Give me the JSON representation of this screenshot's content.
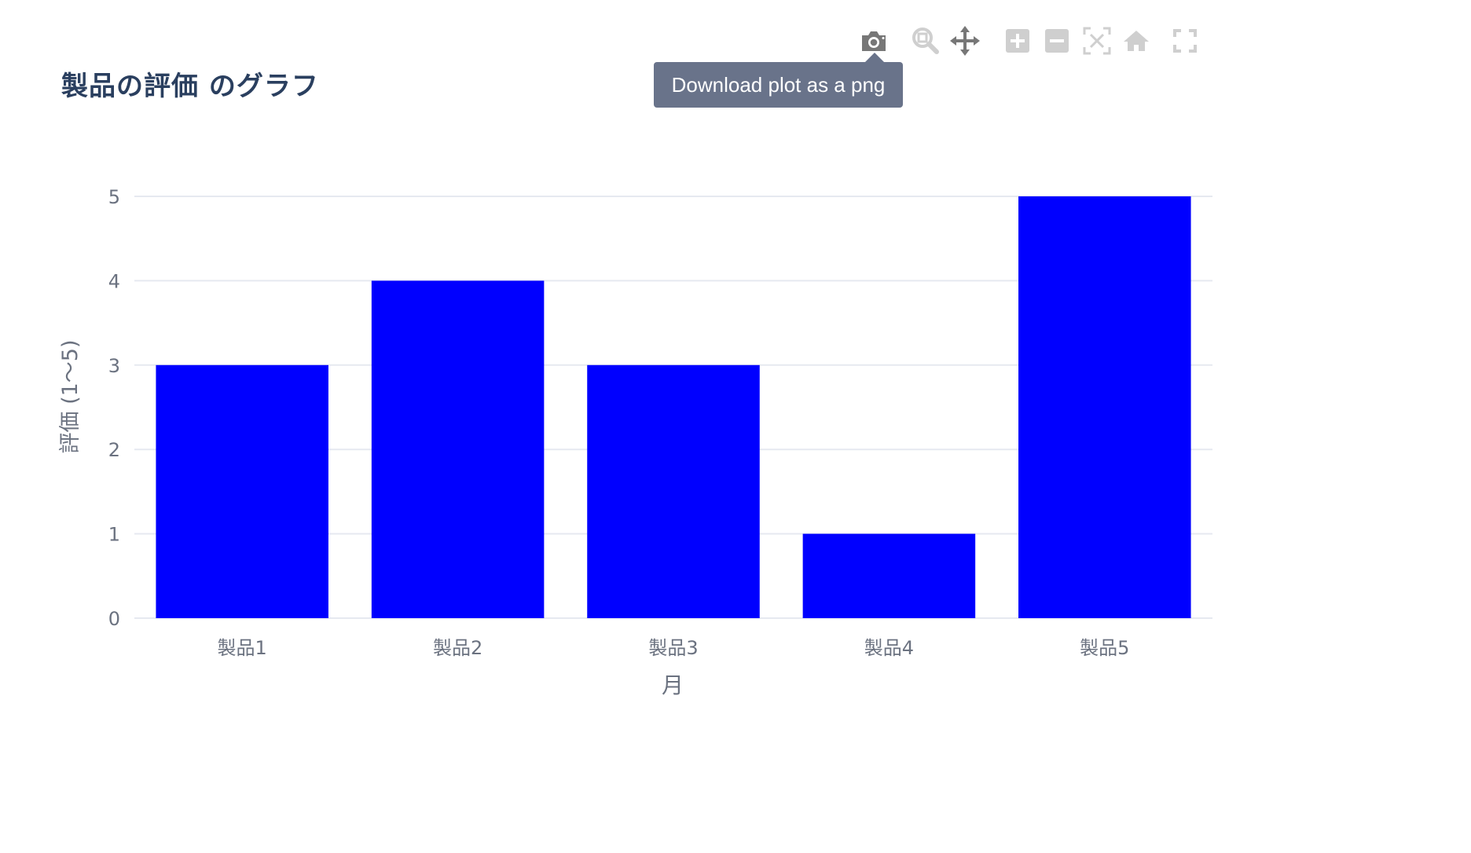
{
  "chart_data": {
    "type": "bar",
    "title": "製品の評価 のグラフ",
    "xlabel": "月",
    "ylabel": "評価 (1〜5)",
    "categories": [
      "製品1",
      "製品2",
      "製品3",
      "製品4",
      "製品5"
    ],
    "values": [
      3,
      4,
      3,
      1,
      5
    ],
    "ylim": [
      0,
      5
    ],
    "yticks": [
      "0",
      "1",
      "2",
      "3",
      "4",
      "5"
    ],
    "bar_color": "#0000ff",
    "grid": true,
    "legend": false
  },
  "modebar": {
    "tooltip": "Download plot as a png",
    "buttons": [
      {
        "name": "camera-icon"
      },
      {
        "name": "zoom-icon"
      },
      {
        "name": "pan-icon"
      },
      {
        "name": "zoom-in-icon"
      },
      {
        "name": "zoom-out-icon"
      },
      {
        "name": "autoscale-icon"
      },
      {
        "name": "reset-axes-icon"
      },
      {
        "name": "fullscreen-icon"
      }
    ]
  },
  "colors": {
    "grid": "#e6e9f0",
    "axis_text": "#6b7280",
    "title": "#2a3f5f",
    "icon_active": "#777777",
    "icon_inactive": "#cfcfcf",
    "tooltip_bg": "#69738a"
  }
}
